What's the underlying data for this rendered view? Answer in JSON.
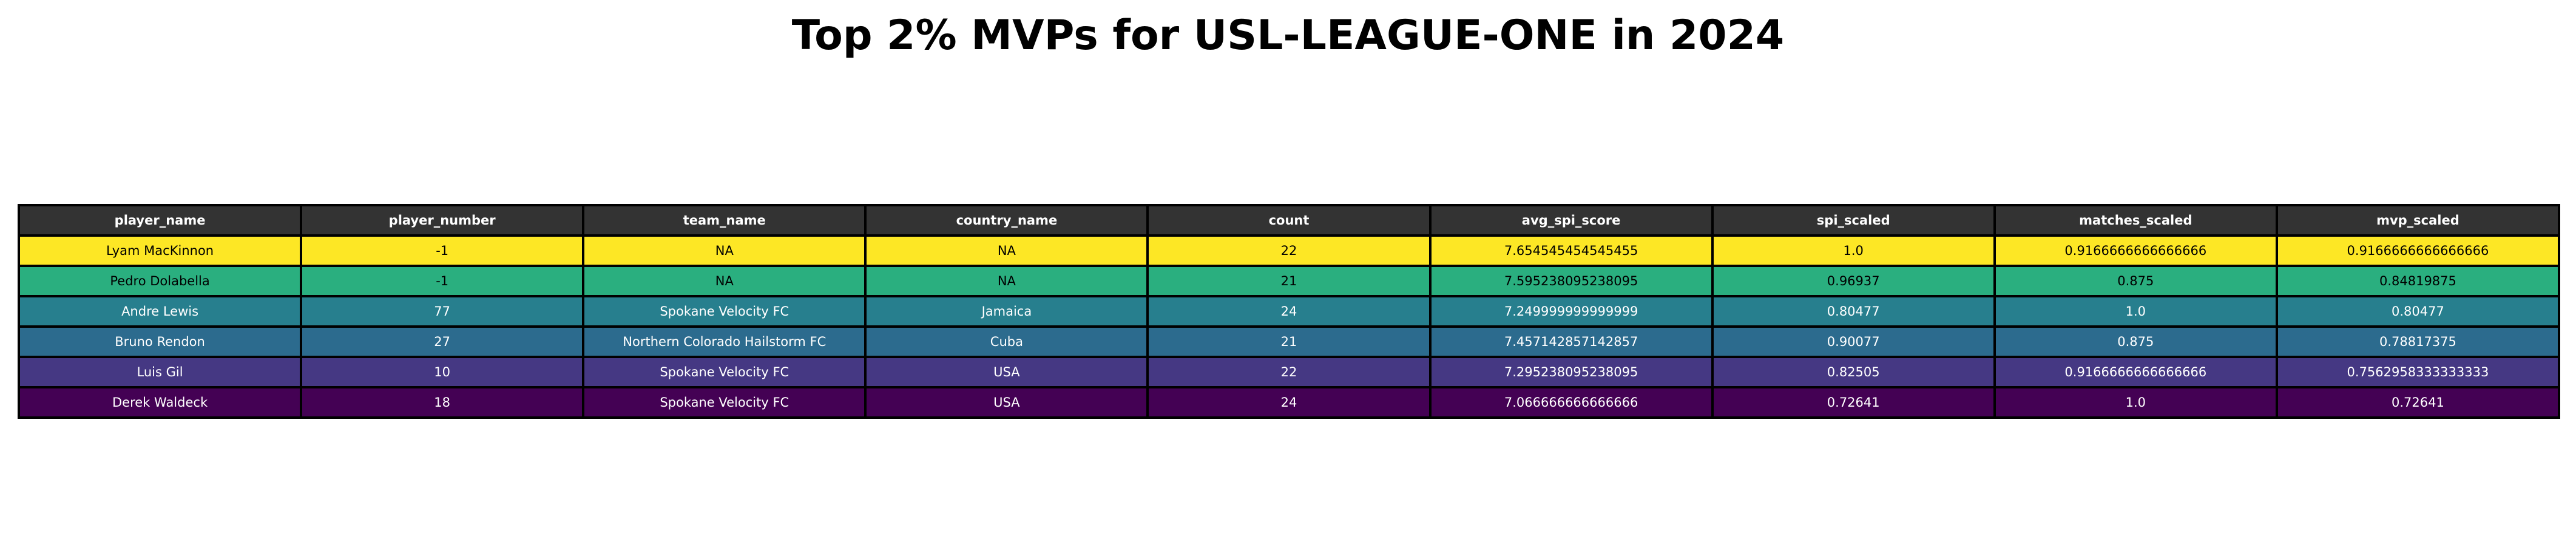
{
  "chart_data": {
    "type": "table",
    "title": "Top 2% MVPs for USL-LEAGUE-ONE in 2024",
    "header_color": "#333333",
    "columns": [
      "player_name",
      "player_number",
      "team_name",
      "country_name",
      "count",
      "avg_spi_score",
      "spi_scaled",
      "matches_scaled",
      "mvp_scaled"
    ],
    "rows": [
      {
        "cells": [
          "Lyam MacKinnon",
          "-1",
          "NA",
          "NA",
          "22",
          "7.654545454545455",
          "1.0",
          "0.9166666666666666",
          "0.9166666666666666"
        ],
        "color": "#fde725",
        "text_color": "#000000"
      },
      {
        "cells": [
          "Pedro Dolabella",
          "-1",
          "NA",
          "NA",
          "21",
          "7.595238095238095",
          "0.96937",
          "0.875",
          "0.84819875"
        ],
        "color": "#2aaf7f",
        "text_color": "#000000"
      },
      {
        "cells": [
          "Andre Lewis",
          "77",
          "Spokane Velocity FC",
          "Jamaica",
          "24",
          "7.249999999999999",
          "0.80477",
          "1.0",
          "0.80477"
        ],
        "color": "#277f8e",
        "text_color": "#ffffff"
      },
      {
        "cells": [
          "Bruno Rendon",
          "27",
          "Northern Colorado Hailstorm FC",
          "Cuba",
          "21",
          "7.457142857142857",
          "0.90077",
          "0.875",
          "0.78817375"
        ],
        "color": "#2c6b8e",
        "text_color": "#ffffff"
      },
      {
        "cells": [
          "Luis Gil",
          "10",
          "Spokane Velocity FC",
          "USA",
          "22",
          "7.295238095238095",
          "0.82505",
          "0.9166666666666666",
          "0.7562958333333333"
        ],
        "color": "#453883",
        "text_color": "#ffffff"
      },
      {
        "cells": [
          "Derek Waldeck",
          "18",
          "Spokane Velocity FC",
          "USA",
          "24",
          "7.066666666666666",
          "0.72641",
          "1.0",
          "0.72641"
        ],
        "color": "#440154",
        "text_color": "#ffffff"
      }
    ]
  }
}
